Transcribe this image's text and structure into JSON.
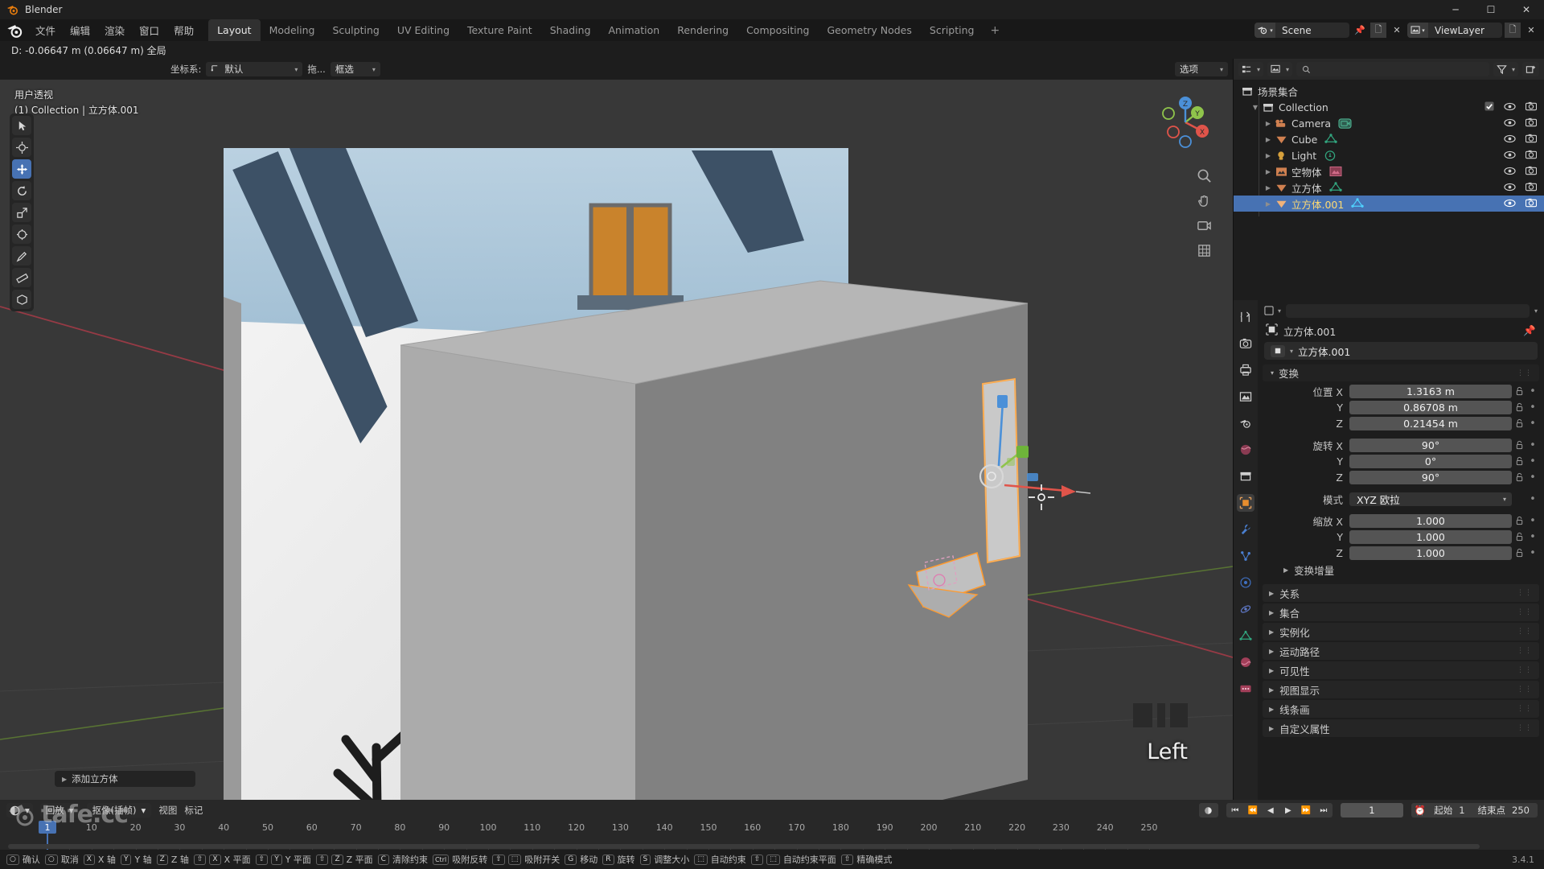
{
  "window": {
    "title": "Blender",
    "minimize": "─",
    "maximize": "☐",
    "close": "✕"
  },
  "topbar": {
    "menus": [
      "文件",
      "编辑",
      "渲染",
      "窗口",
      "帮助"
    ],
    "workspaces": [
      {
        "label": "Layout",
        "active": true
      },
      {
        "label": "Modeling",
        "active": false
      },
      {
        "label": "Sculpting",
        "active": false
      },
      {
        "label": "UV Editing",
        "active": false
      },
      {
        "label": "Texture Paint",
        "active": false
      },
      {
        "label": "Shading",
        "active": false
      },
      {
        "label": "Animation",
        "active": false
      },
      {
        "label": "Rendering",
        "active": false
      },
      {
        "label": "Compositing",
        "active": false
      },
      {
        "label": "Geometry Nodes",
        "active": false
      },
      {
        "label": "Scripting",
        "active": false
      }
    ],
    "add_workspace": "+",
    "scene_name": "Scene",
    "viewlayer_name": "ViewLayer"
  },
  "operator_status": "D: -0.06647 m (0.06647 m) 全局",
  "viewport": {
    "header": {
      "orientation_label": "坐标系:",
      "orientation_value": "默认",
      "drag_label": "拖...",
      "drag_value": "框选",
      "options": "选项"
    },
    "info_line1": "用户透视",
    "info_line2": "(1) Collection | 立方体.001",
    "axis_label": "Left",
    "operator_panel": "添加立方体",
    "gizmo_axes": [
      {
        "name": "X",
        "color": "#e0544a"
      },
      {
        "name": "Y",
        "color": "#8fc44b"
      },
      {
        "name": "Z",
        "color": "#4b90d8"
      }
    ],
    "tools": [
      {
        "name": "tweak-tool",
        "active": false
      },
      {
        "name": "cursor-tool",
        "active": false
      },
      {
        "name": "move-tool",
        "active": true
      },
      {
        "name": "rotate-tool",
        "active": false
      },
      {
        "name": "scale-tool",
        "active": false
      },
      {
        "name": "transform-tool",
        "active": false
      },
      {
        "name": "annotate-tool",
        "active": false
      },
      {
        "name": "measure-tool",
        "active": false
      },
      {
        "name": "add-cube-tool",
        "active": false
      }
    ]
  },
  "outliner": {
    "display_mode": "view-layer",
    "search_placeholder": "",
    "scene_collection": "场景集合",
    "items": [
      {
        "label": "Collection",
        "indent": 0,
        "type": "collection",
        "selected": false,
        "checkbox": true
      },
      {
        "label": "Camera",
        "indent": 1,
        "type": "camera",
        "selected": false,
        "data_icon": "camera-data"
      },
      {
        "label": "Cube",
        "indent": 1,
        "type": "mesh",
        "selected": false,
        "data_icon": "mesh-data"
      },
      {
        "label": "Light",
        "indent": 1,
        "type": "light",
        "selected": false,
        "data_icon": "light-data"
      },
      {
        "label": "空物体",
        "indent": 1,
        "type": "empty-image",
        "selected": false,
        "data_icon": "image-data"
      },
      {
        "label": "立方体",
        "indent": 1,
        "type": "mesh",
        "selected": false,
        "data_icon": "mesh-data"
      },
      {
        "label": "立方体.001",
        "indent": 1,
        "type": "mesh",
        "selected": true,
        "data_icon": "mesh-data"
      }
    ]
  },
  "properties": {
    "breadcrumb_object": "立方体.001",
    "id_name": "立方体.001",
    "transform_panel": "变换",
    "rows": [
      {
        "label": "位置 X",
        "value": "1.3163 m"
      },
      {
        "label": "Y",
        "value": "0.86708 m"
      },
      {
        "label": "Z",
        "value": "0.21454 m"
      },
      {
        "label": "旋转 X",
        "value": "90°"
      },
      {
        "label": "Y",
        "value": "0°"
      },
      {
        "label": "Z",
        "value": "90°"
      }
    ],
    "mode_label": "模式",
    "mode_value": "XYZ 欧拉",
    "scale_rows": [
      {
        "label": "缩放 X",
        "value": "1.000"
      },
      {
        "label": "Y",
        "value": "1.000"
      },
      {
        "label": "Z",
        "value": "1.000"
      }
    ],
    "delta_transform": "变换增量",
    "sections": [
      "关系",
      "集合",
      "实例化",
      "运动路径",
      "可见性",
      "视图显示",
      "线条画",
      "自定义属性"
    ],
    "tabs": [
      {
        "name": "tool-tab",
        "active": false
      },
      {
        "name": "render-tab",
        "active": false
      },
      {
        "name": "output-tab",
        "active": false
      },
      {
        "name": "view-layer-tab",
        "active": false
      },
      {
        "name": "scene-tab",
        "active": false
      },
      {
        "name": "world-tab",
        "active": false
      },
      {
        "name": "collection-tab",
        "active": false
      },
      {
        "name": "object-tab",
        "active": true
      },
      {
        "name": "modifier-tab",
        "active": false
      },
      {
        "name": "particles-tab",
        "active": false
      },
      {
        "name": "physics-tab",
        "active": false
      },
      {
        "name": "constraint-tab",
        "active": false
      },
      {
        "name": "object-data-tab",
        "active": false
      },
      {
        "name": "material-tab",
        "active": false
      },
      {
        "name": "texture-tab",
        "active": false
      }
    ]
  },
  "timeline": {
    "playback": "回放",
    "keying": "抠像(插帧)",
    "view": "视图",
    "marker": "标记",
    "current_frame": "1",
    "start_label": "起始",
    "start_value": "1",
    "end_label": "结束点",
    "end_value": "250",
    "ticks": [
      "10",
      "20",
      "30",
      "40",
      "50",
      "60",
      "70",
      "80",
      "90",
      "100",
      "110",
      "120",
      "130",
      "140",
      "150",
      "160",
      "170",
      "180",
      "190",
      "200",
      "210",
      "220",
      "230",
      "240",
      "250"
    ],
    "playhead_frame": "1"
  },
  "statusbar": {
    "items": [
      {
        "keys": [
          "○"
        ],
        "label": "确认"
      },
      {
        "keys": [
          "○"
        ],
        "label": "取消"
      },
      {
        "keys": [
          "X"
        ],
        "label": "X 轴"
      },
      {
        "keys": [
          "Y"
        ],
        "label": "Y 轴"
      },
      {
        "keys": [
          "Z"
        ],
        "label": "Z 轴"
      },
      {
        "keys": [
          "⇧",
          "X"
        ],
        "label": "X 平面"
      },
      {
        "keys": [
          "⇧",
          "Y"
        ],
        "label": "Y 平面"
      },
      {
        "keys": [
          "⇧",
          "Z"
        ],
        "label": "Z 平面"
      },
      {
        "keys": [
          "C"
        ],
        "label": "清除约束"
      },
      {
        "keys": [
          "Ctrl"
        ],
        "label": "吸附反转"
      },
      {
        "keys": [
          "⇧",
          "⬚"
        ],
        "label": "吸附开关"
      },
      {
        "keys": [
          "G"
        ],
        "label": "移动"
      },
      {
        "keys": [
          "R"
        ],
        "label": "旋转"
      },
      {
        "keys": [
          "S"
        ],
        "label": "调整大小"
      },
      {
        "keys": [
          "⬚"
        ],
        "label": "自动约束"
      },
      {
        "keys": [
          "⇧",
          "⬚"
        ],
        "label": "自动约束平面"
      },
      {
        "keys": [
          "⇧"
        ],
        "label": "精确模式"
      }
    ],
    "version": "3.4.1"
  },
  "watermark": "tafe.cc",
  "colors": {
    "accent_blue": "#4772b3",
    "axis_x": "#e0544a",
    "axis_y": "#8fc44b",
    "axis_z": "#4b90d8",
    "background": "#1d1d1d",
    "viewport_bg": "#353535"
  }
}
